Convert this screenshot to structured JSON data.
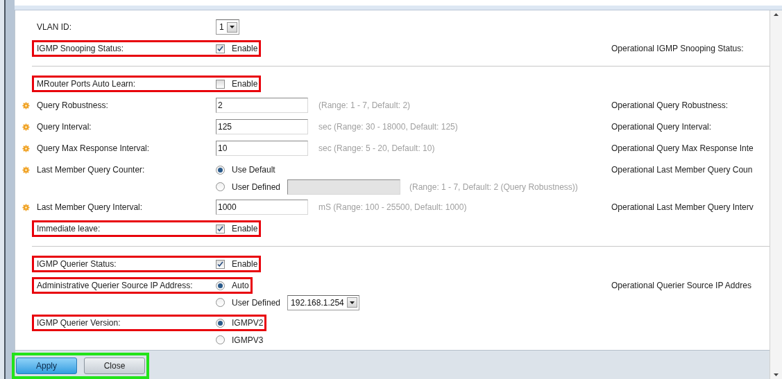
{
  "rows": [
    {
      "kind": "select",
      "label": "VLAN ID:",
      "required": false,
      "highlighted": false,
      "value": "1"
    },
    {
      "kind": "checkbox",
      "label": "IGMP Snooping Status:",
      "required": false,
      "highlighted": true,
      "option": "Enable",
      "checked": true,
      "operational": "Operational IGMP Snooping Status:"
    },
    {
      "kind": "divider"
    },
    {
      "kind": "checkbox",
      "label": "MRouter Ports Auto Learn:",
      "required": false,
      "highlighted": true,
      "option": "Enable",
      "checked": false
    },
    {
      "kind": "text",
      "label": "Query Robustness:",
      "required": true,
      "highlighted": false,
      "value": "2",
      "hint": "(Range: 1 - 7, Default: 2)",
      "operational": "Operational Query Robustness:"
    },
    {
      "kind": "text",
      "label": "Query Interval:",
      "required": true,
      "highlighted": false,
      "value": "125",
      "hint": "sec (Range: 30 - 18000, Default: 125)",
      "operational": "Operational Query Interval:"
    },
    {
      "kind": "text",
      "label": "Query Max Response Interval:",
      "required": true,
      "highlighted": false,
      "value": "10",
      "hint": "sec (Range: 5 - 20, Default: 10)",
      "operational": "Operational Query Max Response Inte"
    },
    {
      "kind": "radio",
      "label": "Last Member Query Counter:",
      "required": true,
      "highlighted": false,
      "operational": "Operational Last Member Query Coun",
      "options": [
        {
          "label": "Use Default",
          "selected": true
        },
        {
          "label": "User Defined",
          "selected": false,
          "input": {
            "kind": "text",
            "disabled": true
          },
          "hint": "(Range: 1 - 7, Default: 2 (Query Robustness))"
        }
      ]
    },
    {
      "kind": "text",
      "label": "Last Member Query Interval:",
      "required": true,
      "highlighted": false,
      "value": "1000",
      "hint": "mS (Range: 100 - 25500, Default: 1000)",
      "operational": "Operational Last Member Query Interv"
    },
    {
      "kind": "checkbox",
      "label": "Immediate leave:",
      "required": false,
      "highlighted": true,
      "option": "Enable",
      "checked": true
    },
    {
      "kind": "divider"
    },
    {
      "kind": "checkbox",
      "label": "IGMP Querier Status:",
      "required": false,
      "highlighted": true,
      "option": "Enable",
      "checked": true
    },
    {
      "kind": "radio",
      "label": "Administrative Querier Source IP Address:",
      "required": false,
      "highlighted": true,
      "operational": "Operational Querier Source IP Addres",
      "options": [
        {
          "label": "Auto",
          "selected": true
        },
        {
          "label": "User Defined",
          "selected": false,
          "input": {
            "kind": "select",
            "value": "192.168.1.254"
          }
        }
      ]
    },
    {
      "kind": "radio",
      "label": "IGMP Querier Version:",
      "required": false,
      "highlighted": true,
      "options": [
        {
          "label": "IGMPV2",
          "selected": true
        },
        {
          "label": "IGMPV3",
          "selected": false
        }
      ]
    }
  ],
  "footer": {
    "highlighted": true,
    "buttons": [
      {
        "label": "Apply",
        "kind": "primary"
      },
      {
        "label": "Close",
        "kind": "secondary"
      }
    ]
  }
}
